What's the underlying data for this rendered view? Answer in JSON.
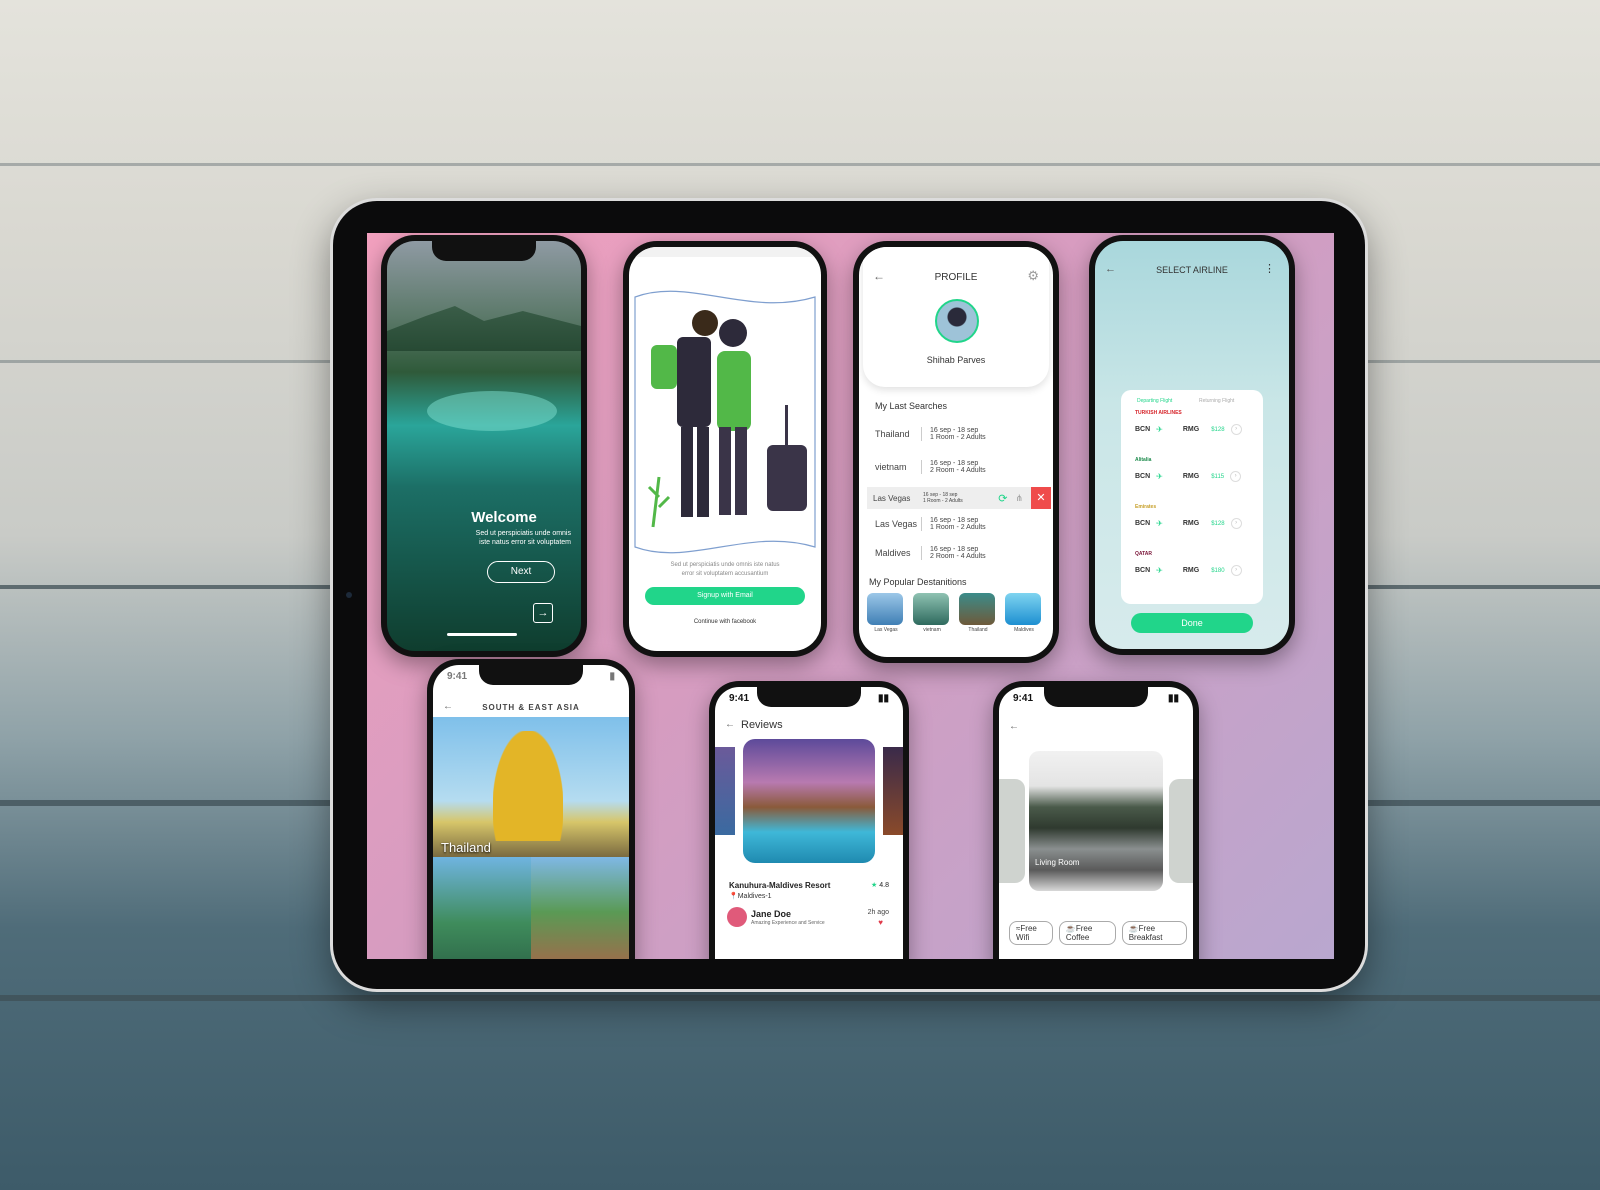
{
  "welcome": {
    "title": "Welcome",
    "subtitle_line1": "Sed ut perspiciatis unde omnis",
    "subtitle_line2": "iste natus error sit voluptatem",
    "next_label": "Next",
    "arrow_icon": "arrow-right-icon"
  },
  "signup": {
    "text_line1": "Sed ut perspiciatis unde omnis iste natus",
    "text_line2": "error sit voluptatem accusantium",
    "email_button": "Signup with Email",
    "facebook_link": "Continue with facebook"
  },
  "profile": {
    "title": "PROFILE",
    "name": "Shihab Parves",
    "last_searches_heading": "My Last Searches",
    "searches": [
      {
        "place": "Thailand",
        "dates": "16 sep - 18 sep",
        "rooms": "1 Room - 2 Adults"
      },
      {
        "place": "vietnam",
        "dates": "16 sep - 18 sep",
        "rooms": "2 Room - 4 Adults"
      },
      {
        "place": "Las Vegas",
        "dates": "16 sep - 18 sep",
        "rooms": "1 Room - 2 Adults"
      },
      {
        "place": "Las Vegas",
        "dates": "16 sep - 18 sep",
        "rooms": "1 Room - 2 Adults"
      },
      {
        "place": "Maldives",
        "dates": "16 sep - 18 sep",
        "rooms": "2 Room - 4 Adults"
      }
    ],
    "popular_heading": "My Popular Destanitions",
    "popular": [
      {
        "name": "Las Vegas",
        "colors": [
          "#3f7fb5",
          "#9cc7e8"
        ]
      },
      {
        "name": "vietnam",
        "colors": [
          "#2e6a5e",
          "#8fc2b2"
        ]
      },
      {
        "name": "Thailand",
        "colors": [
          "#6e5a3a",
          "#3b8c8a"
        ]
      },
      {
        "name": "Maldives",
        "colors": [
          "#1d8fd1",
          "#7fd4f0"
        ]
      }
    ]
  },
  "airline": {
    "title": "SELECT AIRLINE",
    "tab_departing": "Departing Flight",
    "tab_returning": "Returning Flight",
    "flights": [
      {
        "airline": "TURKISH AIRLINES",
        "from": "BCN",
        "to": "RMG",
        "price": "$128",
        "logo_color": "#d6242a"
      },
      {
        "airline": "Alitalia",
        "from": "BCN",
        "to": "RMG",
        "price": "$115",
        "logo_color": "#1a8a4a"
      },
      {
        "airline": "Emirates",
        "from": "BCN",
        "to": "RMG",
        "price": "$128",
        "logo_color": "#c7a02a"
      },
      {
        "airline": "QATAR",
        "from": "BCN",
        "to": "RMG",
        "price": "$180",
        "logo_color": "#7a1538"
      }
    ],
    "done_label": "Done"
  },
  "asia": {
    "time": "9:41",
    "title": "SOUTH & EAST ASIA",
    "first_card": "Thailand"
  },
  "reviews": {
    "time": "9:41",
    "title": "Reviews",
    "resort": "Kanuhura-Maldives Resort",
    "rating": "4.8",
    "location": "Maldives-1",
    "reviewer": "Jane Doe",
    "review_text": "Amazing Experience and Service",
    "ago": "2h ago"
  },
  "room": {
    "time": "9:41",
    "label": "Living Room",
    "amenities": [
      "Free Wifi",
      "Free Coffee",
      "Free Breakfast"
    ]
  },
  "colors": {
    "accent": "#21d58a",
    "tablet": "#0b0b0c"
  }
}
